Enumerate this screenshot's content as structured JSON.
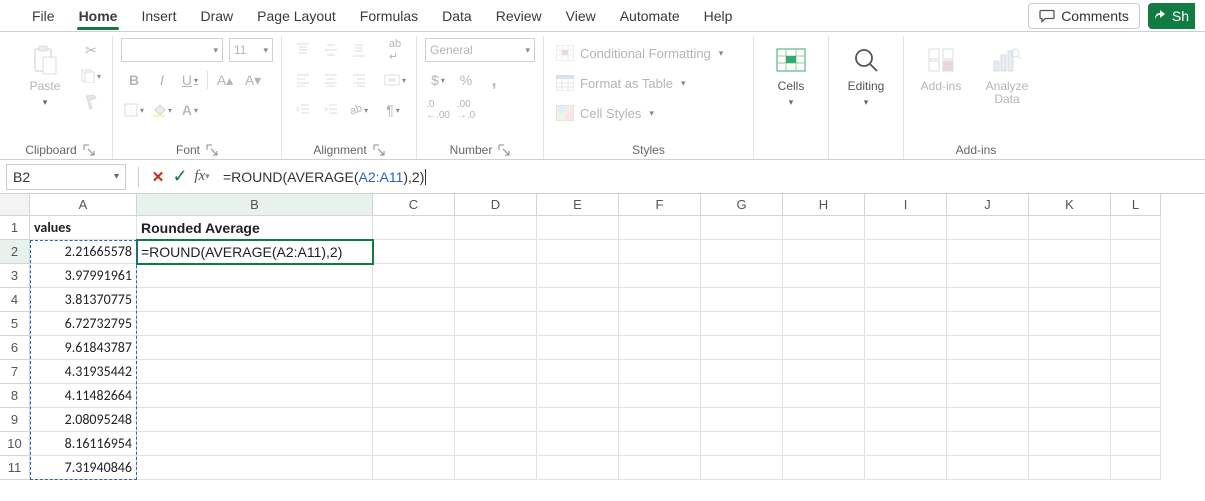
{
  "tabs": [
    "File",
    "Home",
    "Insert",
    "Draw",
    "Page Layout",
    "Formulas",
    "Data",
    "Review",
    "View",
    "Automate",
    "Help"
  ],
  "active_tab": "Home",
  "comments_label": "Comments",
  "share_label": "Sh",
  "ribbon": {
    "clipboard": {
      "paste": "Paste",
      "label": "Clipboard"
    },
    "font": {
      "label": "Font",
      "size": "11",
      "bold": "B",
      "italic": "I",
      "underline": "U"
    },
    "alignment": {
      "label": "Alignment"
    },
    "number": {
      "label": "Number",
      "format": "General"
    },
    "styles": {
      "label": "Styles",
      "cond": "Conditional Formatting",
      "table": "Format as Table",
      "cell": "Cell Styles"
    },
    "cells": {
      "label": "Cells"
    },
    "editing": {
      "label": "Editing"
    },
    "addins": {
      "btn": "Add-ins",
      "label": "Add-ins"
    },
    "analyze": {
      "line1": "Analyze",
      "line2": "Data"
    }
  },
  "namebox": "B2",
  "formula": {
    "prefix": "=ROUND(AVERAGE(",
    "ref": "A2:A11",
    "suffix": "),2)"
  },
  "columns": [
    "A",
    "B",
    "C",
    "D",
    "E",
    "F",
    "G",
    "H",
    "I",
    "J",
    "K",
    "L"
  ],
  "headers": {
    "A": "values",
    "B": "Rounded Average"
  },
  "cell_B2": "=ROUND(AVERAGE(A2:A11),2)",
  "valuesA": [
    "2.21665578",
    "3.97991961",
    "3.81370775",
    "6.72732795",
    "9.61843787",
    "4.31935442",
    "4.11482664",
    "2.08095248",
    "8.16116954",
    "7.31940846"
  ],
  "chart_data": {
    "type": "table",
    "title": "",
    "columns": [
      "values",
      "Rounded Average"
    ],
    "rows": [
      [
        2.21665578,
        "=ROUND(AVERAGE(A2:A11),2)"
      ],
      [
        3.97991961,
        null
      ],
      [
        3.81370775,
        null
      ],
      [
        6.72732795,
        null
      ],
      [
        9.61843787,
        null
      ],
      [
        4.31935442,
        null
      ],
      [
        4.11482664,
        null
      ],
      [
        2.08095248,
        null
      ],
      [
        8.16116954,
        null
      ],
      [
        7.31940846,
        null
      ]
    ]
  }
}
